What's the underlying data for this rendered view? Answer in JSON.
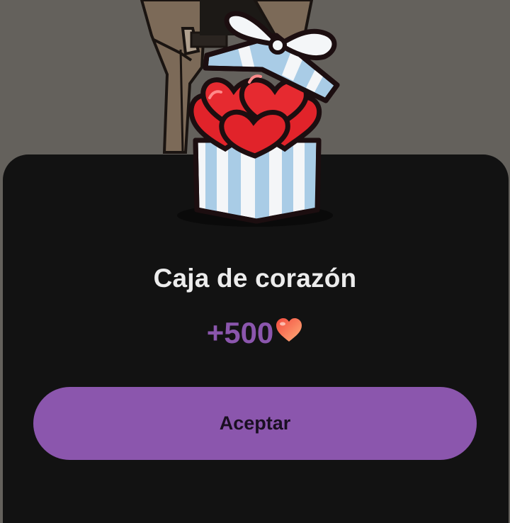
{
  "dialog": {
    "title": "Caja de corazón",
    "reward_amount": "+500",
    "reward_icon": "heart-icon",
    "accept_label": "Aceptar"
  },
  "colors": {
    "backdrop": "#64615c",
    "sheet": "#121212",
    "accent": "#8b56ad",
    "title_text": "#ececec"
  }
}
